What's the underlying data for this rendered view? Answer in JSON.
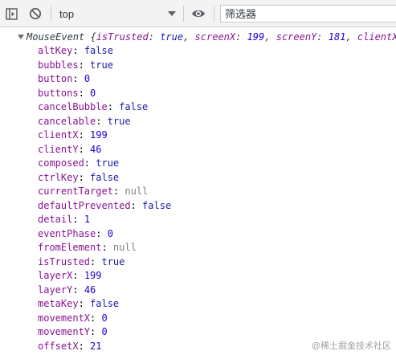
{
  "toolbar": {
    "context_label": "top",
    "filter_placeholder": "筛选器"
  },
  "console": {
    "object_header": {
      "type_name": "MouseEvent",
      "preview": [
        {
          "key": "isTrusted",
          "value": "true"
        },
        {
          "key": "screenX",
          "value": "199"
        },
        {
          "key": "screenY",
          "value": "181"
        },
        {
          "key": "clientX",
          "value": ""
        }
      ]
    },
    "properties": [
      {
        "key": "altKey",
        "value": "false",
        "kind": "bool"
      },
      {
        "key": "bubbles",
        "value": "true",
        "kind": "bool"
      },
      {
        "key": "button",
        "value": "0",
        "kind": "num"
      },
      {
        "key": "buttons",
        "value": "0",
        "kind": "num"
      },
      {
        "key": "cancelBubble",
        "value": "false",
        "kind": "bool"
      },
      {
        "key": "cancelable",
        "value": "true",
        "kind": "bool"
      },
      {
        "key": "clientX",
        "value": "199",
        "kind": "num"
      },
      {
        "key": "clientY",
        "value": "46",
        "kind": "num"
      },
      {
        "key": "composed",
        "value": "true",
        "kind": "bool"
      },
      {
        "key": "ctrlKey",
        "value": "false",
        "kind": "bool"
      },
      {
        "key": "currentTarget",
        "value": "null",
        "kind": "null"
      },
      {
        "key": "defaultPrevented",
        "value": "false",
        "kind": "bool"
      },
      {
        "key": "detail",
        "value": "1",
        "kind": "num"
      },
      {
        "key": "eventPhase",
        "value": "0",
        "kind": "num"
      },
      {
        "key": "fromElement",
        "value": "null",
        "kind": "null"
      },
      {
        "key": "isTrusted",
        "value": "true",
        "kind": "bool"
      },
      {
        "key": "layerX",
        "value": "199",
        "kind": "num"
      },
      {
        "key": "layerY",
        "value": "46",
        "kind": "num"
      },
      {
        "key": "metaKey",
        "value": "false",
        "kind": "bool"
      },
      {
        "key": "movementX",
        "value": "0",
        "kind": "num"
      },
      {
        "key": "movementY",
        "value": "0",
        "kind": "num"
      },
      {
        "key": "offsetX",
        "value": "21",
        "kind": "num"
      }
    ]
  },
  "watermark": "@稀土掘金技术社区",
  "colors": {
    "property_key": "#881391",
    "boolean_value": "#1a1aa6",
    "number_value": "#1c00cf",
    "null_value": "#808080",
    "toolbar_bg": "#f3f3f3"
  },
  "icons": [
    "sidebar-toggle-icon",
    "clear-console-icon",
    "dropdown-arrow-icon",
    "eye-icon"
  ]
}
